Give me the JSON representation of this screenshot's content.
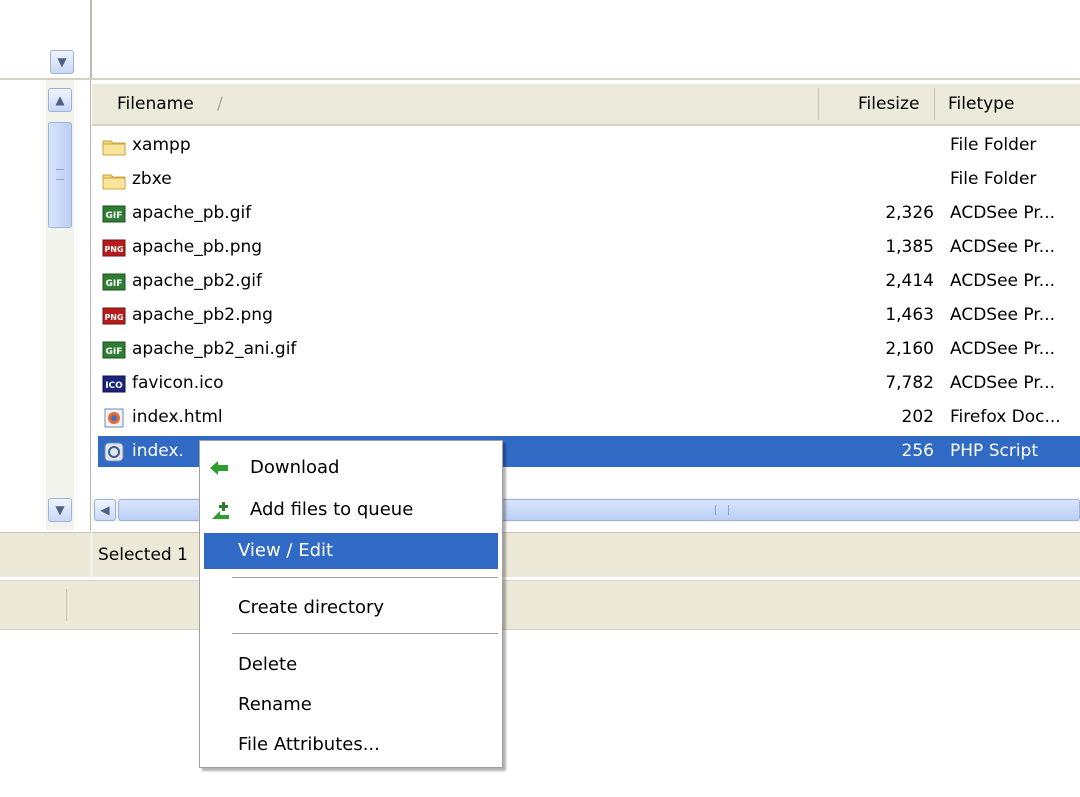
{
  "file_list": {
    "headers": {
      "filename": "Filename",
      "sort_indicator": "/",
      "filesize": "Filesize",
      "filetype": "Filetype"
    },
    "rows": [
      {
        "name": "xampp",
        "size": "",
        "type": "File Folder",
        "icon": "folder-icon"
      },
      {
        "name": "zbxe",
        "size": "",
        "type": "File Folder",
        "icon": "folder-icon"
      },
      {
        "name": "apache_pb.gif",
        "size": "2,326",
        "type": "ACDSee Pr...",
        "icon": "gif-file-icon"
      },
      {
        "name": "apache_pb.png",
        "size": "1,385",
        "type": "ACDSee Pr...",
        "icon": "png-file-icon"
      },
      {
        "name": "apache_pb2.gif",
        "size": "2,414",
        "type": "ACDSee Pr...",
        "icon": "gif-file-icon"
      },
      {
        "name": "apache_pb2.png",
        "size": "1,463",
        "type": "ACDSee Pr...",
        "icon": "png-file-icon"
      },
      {
        "name": "apache_pb2_ani.gif",
        "size": "2,160",
        "type": "ACDSee Pr...",
        "icon": "gif-file-icon"
      },
      {
        "name": "favicon.ico",
        "size": "7,782",
        "type": "ACDSee Pr...",
        "icon": "ico-file-icon"
      },
      {
        "name": "index.html",
        "size": "202",
        "type": "Firefox Doc...",
        "icon": "html-file-icon"
      },
      {
        "name": "index.php",
        "visible_name": "index.",
        "size": "256",
        "type": "PHP Script",
        "icon": "php-file-icon",
        "selected": true
      }
    ]
  },
  "status": {
    "text": "Selected 1"
  },
  "context_menu": {
    "items": [
      {
        "label": "Download",
        "icon": "download-arrow-icon"
      },
      {
        "label": "Add files to queue",
        "icon": "add-queue-icon"
      },
      {
        "label": "View / Edit",
        "highlighted": true
      },
      {
        "label": "Create directory"
      },
      {
        "label": "Delete"
      },
      {
        "label": "Rename"
      },
      {
        "label": "File Attributes..."
      }
    ]
  },
  "colors": {
    "selection": "#316ac5",
    "header_bg": "#ebeadb",
    "statusbar_bg": "#ece9d8"
  }
}
